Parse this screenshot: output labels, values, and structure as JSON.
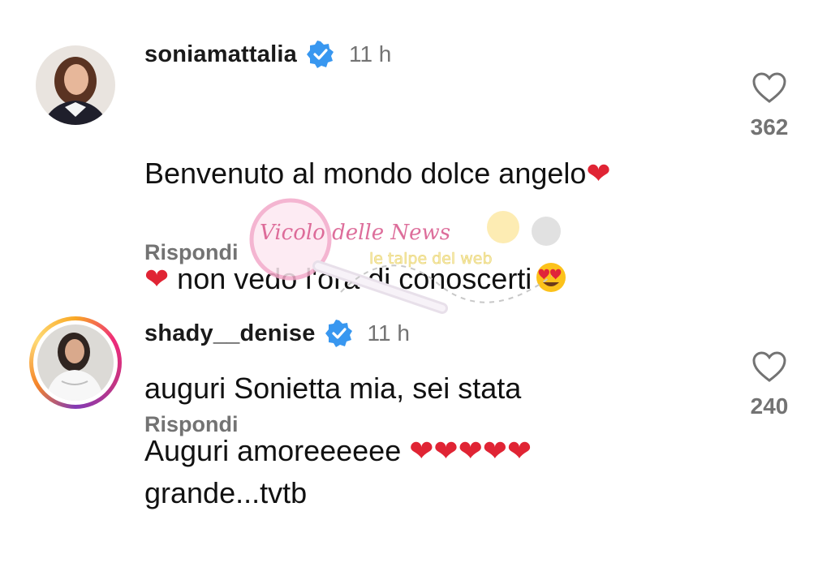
{
  "comments": [
    {
      "username": "soniamattalia",
      "timestamp": "11 h",
      "text_lines": [
        "Benvenuto al mondo dolce angelo",
        " non vedo l'ora di conoscerti",
        "auguri Sonietta mia, sei stata",
        "grande...tvtb"
      ],
      "reply_label": "Rispondi",
      "likes": "362",
      "has_story_ring": false
    },
    {
      "username": "shady__denise",
      "timestamp": "11 h",
      "text_lines": [
        "Auguri amoreeeeee "
      ],
      "reply_label": "Rispondi",
      "likes": "240",
      "has_story_ring": true
    }
  ],
  "icons": {
    "verified": "verified-badge-icon",
    "like": "heart-outline-icon",
    "heart_emoji": "red-heart-emoji",
    "heart_eyes_emoji": "heart-eyes-emoji"
  },
  "watermark": {
    "logo_text": "Vicolo delle News",
    "logo_text_2": "le talpe del web"
  },
  "colors": {
    "verified_blue": "#3897f0",
    "secondary_text": "#737373",
    "heart_red": "#e02434"
  }
}
